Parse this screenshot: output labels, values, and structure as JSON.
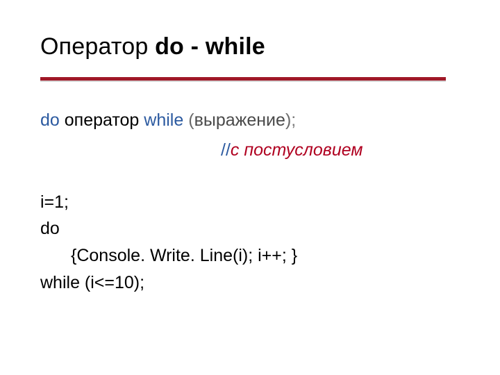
{
  "title": {
    "prefix": "Оператор ",
    "bold": "do - while"
  },
  "syntax": {
    "do": "do",
    "operator_word": " оператор ",
    "while": "while",
    "lparen": " (",
    "expr": "выражение",
    "rparen": ")",
    "semicolon": ";"
  },
  "comment": {
    "slashes": "//",
    "text": "с постусловием"
  },
  "code": {
    "l1": "i=1;",
    "l2": "do",
    "l3": "{Console. Write. Line(i); i++; }",
    "l4": "while (i<=10);"
  }
}
